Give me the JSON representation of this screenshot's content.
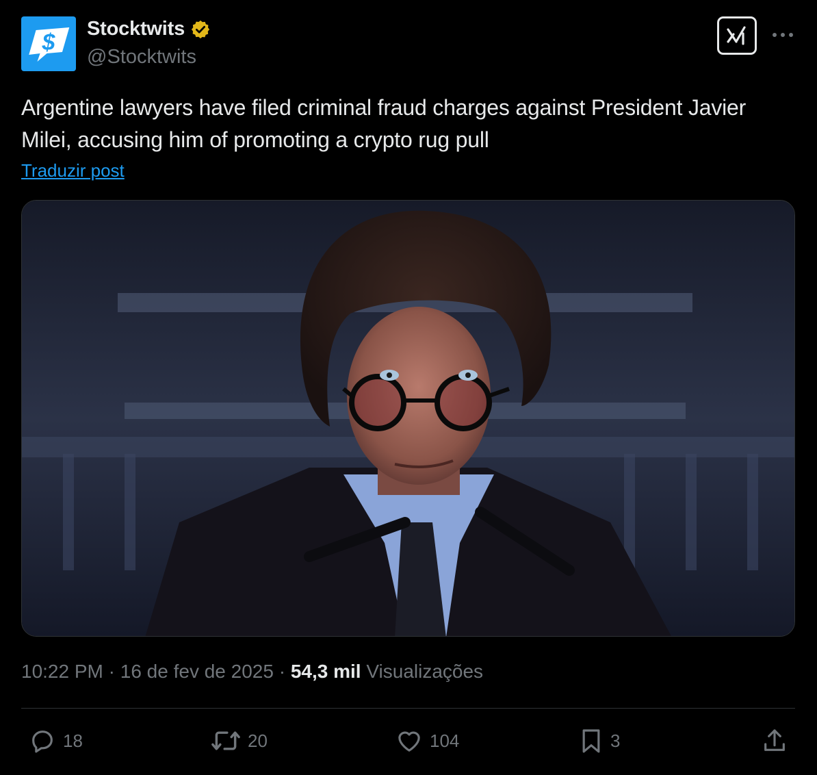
{
  "author": {
    "display_name": "Stocktwits",
    "handle": "@Stocktwits",
    "verified": true,
    "avatar_icon": "stocktwits-logo-icon",
    "avatar_color": "#1d9bf0",
    "badge_color": "#e2b719"
  },
  "post": {
    "text": "Argentine lawyers have filed criminal fraud charges against President Javier Milei, accusing him of promoting a crypto rug pull",
    "translate_label": "Traduzir post",
    "image_icon": "photo-of-javier-milei"
  },
  "meta": {
    "time": "10:22 PM",
    "separator1": " · ",
    "date": "16 de fev de 2025",
    "separator2": " · ",
    "views_count": "54,3 mil",
    "views_label": " Visualizações"
  },
  "actions": {
    "replies": "18",
    "reposts": "20",
    "likes": "104",
    "bookmarks": "3"
  },
  "colors": {
    "background": "#000000",
    "text": "#e7e9ea",
    "secondary": "#71767b",
    "link": "#1d9bf0",
    "border": "#2f3336"
  }
}
